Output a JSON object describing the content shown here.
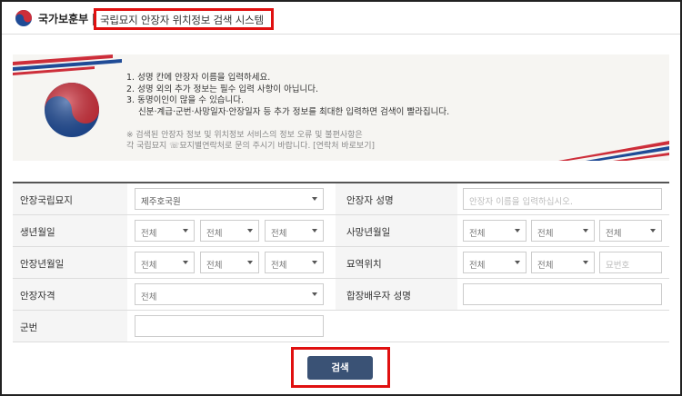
{
  "header": {
    "brand": "국가보훈부",
    "system_title": "국립묘지 안장자 위치정보 검색 시스템"
  },
  "banner": {
    "lines": [
      "1. 성명 칸에 안장자 이름을 입력하세요.",
      "2. 성명 외의 추가 정보는 필수 입력 사항이 아닙니다.",
      "3. 동명이인이 많을 수 있습니다."
    ],
    "sub_line": "신분·계급·군번·사망일자·안장일자 등 추가 정보를 최대한 입력하면 검색이 빨라집니다.",
    "notice_1": "※ 검색된 안장자 정보 및 위치정보 서비스의 정보 오류 및 불편사항은",
    "notice_2": "각 국립묘지 ☏묘지별연락처로 문의 주시기 바랍니다. [연락처 바로보기]"
  },
  "form": {
    "cemetery_label": "안장국립묘지",
    "cemetery_value": "제주호국원",
    "name_label": "안장자 성명",
    "name_placeholder": "안장자 이름을 입력하십시오.",
    "birth_label": "생년월일",
    "death_label": "사망년월일",
    "burial_label": "안장년월일",
    "grave_label": "묘역위치",
    "grave_no_placeholder": "묘번호",
    "qualification_label": "안장자격",
    "spouse_label": "합장배우자 성명",
    "service_no_label": "군번",
    "all": "전체"
  },
  "search_button": "검색",
  "colors": {
    "highlight": "#e01010",
    "button": "#3a5275",
    "label_bg": "#f5f5f5"
  }
}
